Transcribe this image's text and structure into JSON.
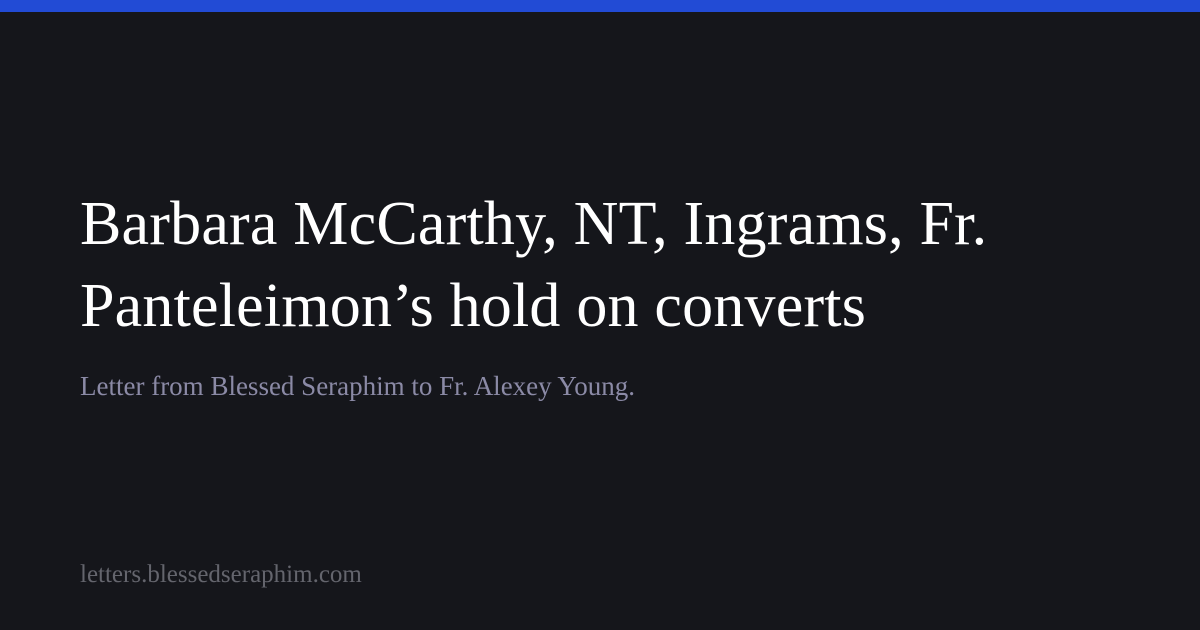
{
  "colors": {
    "accent": "#224bd5",
    "background": "#15161b",
    "title": "#ffffff",
    "subtitle": "#8b8aa6",
    "footer": "#64656d"
  },
  "title": "Barbara McCarthy, NT, Ingrams, Fr. Panteleimon’s hold on converts",
  "subtitle": "Letter from Blessed Seraphim to Fr. Alexey Young.",
  "site": "letters.blessedseraphim.com"
}
